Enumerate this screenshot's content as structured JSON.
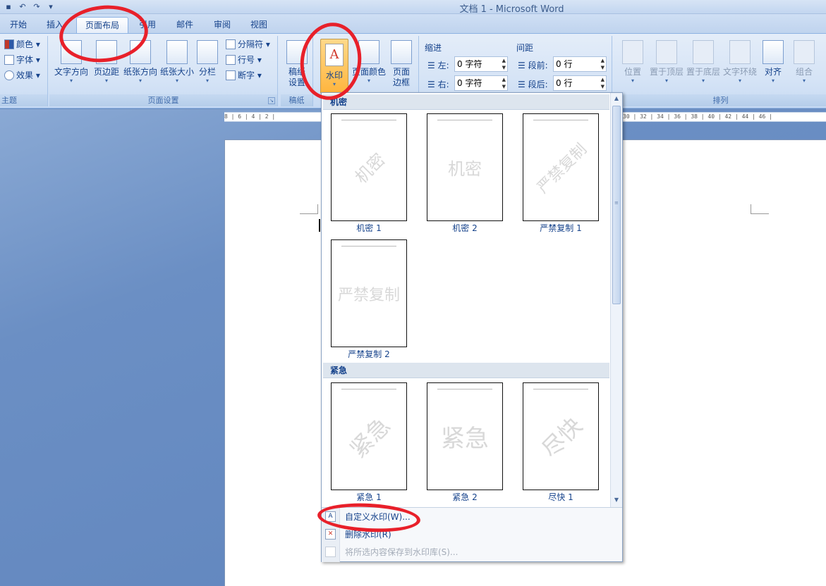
{
  "window": {
    "title": "文档 1 - Microsoft Word",
    "qat_customize": "▾"
  },
  "tabs": [
    "开始",
    "插入",
    "页面布局",
    "引用",
    "邮件",
    "审阅",
    "视图"
  ],
  "active_tab": "页面布局",
  "ribbon": {
    "themes": {
      "label": "主题",
      "colors": "颜色",
      "fonts": "字体",
      "effects": "效果"
    },
    "page_setup": {
      "label": "页面设置",
      "text_direction": "文字方向",
      "margins": "页边距",
      "orientation": "纸张方向",
      "size": "纸张大小",
      "columns": "分栏",
      "breaks": "分隔符",
      "line_numbers": "行号",
      "hyphenation": "断字"
    },
    "manuscript": {
      "label": "稿纸",
      "button_line1": "稿纸",
      "button_line2": "设置"
    },
    "page_background": {
      "watermark": "水印",
      "page_color": "页面颜色",
      "page_borders_line1": "页面",
      "page_borders_line2": "边框"
    },
    "paragraph": {
      "indent_label": "缩进",
      "left_label": "左:",
      "left_value": "0 字符",
      "right_label": "右:",
      "right_value": "0 字符",
      "spacing_label": "间距",
      "before_label": "段前:",
      "before_value": "0 行",
      "after_label": "段后:",
      "after_value": "0 行"
    },
    "arrange": {
      "label": "排列",
      "position": "位置",
      "bring_front": "置于顶层",
      "send_back": "置于底层",
      "text_wrap": "文字环绕",
      "align": "对齐",
      "group": "组合"
    }
  },
  "ruler": {
    "left": "8 | 6 | 4 | 2 |",
    "right": "30 | 32 | 34 | 36 | 38 | 40 | 42 | 44 | 46 |"
  },
  "watermark_gallery": {
    "sections": [
      {
        "title": "机密",
        "items": [
          {
            "caption": "机密 1",
            "text": "机密",
            "style": "diagonal"
          },
          {
            "caption": "机密 2",
            "text": "机密",
            "style": "horizontal"
          },
          {
            "caption": "严禁复制 1",
            "text": "严禁复制",
            "style": "diagonal"
          },
          {
            "caption": "严禁复制 2",
            "text": "严禁复制",
            "style": "horizontal"
          }
        ]
      },
      {
        "title": "紧急",
        "items": [
          {
            "caption": "紧急 1",
            "text": "紧急",
            "style": "diagonal"
          },
          {
            "caption": "紧急 2",
            "text": "紧急",
            "style": "horizontal"
          },
          {
            "caption": "尽快 1",
            "text": "尽快",
            "style": "diagonal"
          }
        ]
      }
    ]
  },
  "menu": {
    "custom": "自定义水印(W)...",
    "remove": "删除水印(R)",
    "save": "将所选内容保存到水印库(S)..."
  },
  "annotation_color": "#e8202a"
}
